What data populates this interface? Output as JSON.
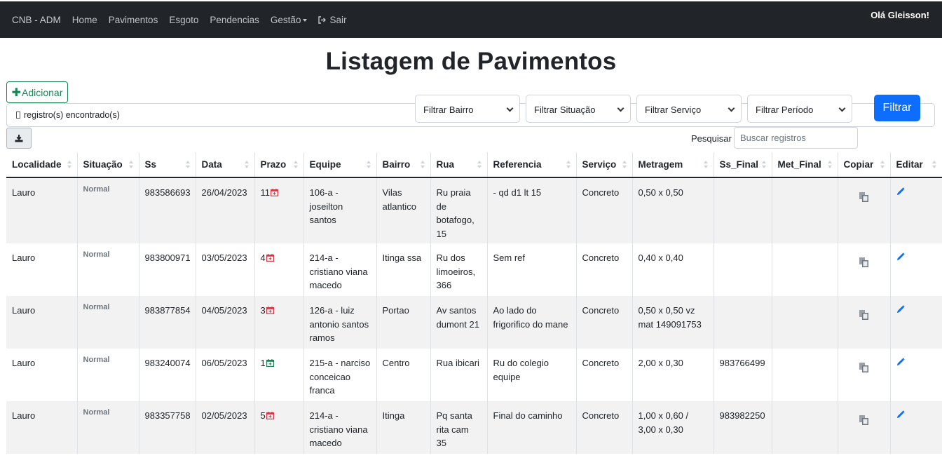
{
  "nav": {
    "brand": "CNB - ADM",
    "home": "Home",
    "pavimentos": "Pavimentos",
    "esgoto": "Esgoto",
    "pendencias": "Pendencias",
    "gestao": "Gestão",
    "sair": "Sair",
    "greeting": "Olá Gleisson!"
  },
  "page": {
    "title": "Listagem de Pavimentos"
  },
  "toolbar": {
    "add_label": "Adicionar",
    "records_text": "registro(s) encontrado(s)",
    "filter_bairro": "Filtrar Bairro",
    "filter_situacao": "Filtrar Situação",
    "filter_servico": "Filtrar Serviço",
    "filter_periodo": "Filtrar Período",
    "filter_button": "Filtrar",
    "search_label": "Pesquisar",
    "search_placeholder": "Buscar registros"
  },
  "table": {
    "headers": [
      "Localidade",
      "Situação",
      "Ss",
      "Data",
      "Prazo",
      "Equipe",
      "Bairro",
      "Rua",
      "Referencia",
      "Serviço",
      "Metragem",
      "Ss_Final",
      "Met_Final",
      "Copiar",
      "Editar"
    ],
    "rows": [
      {
        "localidade": "Lauro",
        "situacao": "Normal",
        "ss": "983586693",
        "data": "26/04/2023",
        "prazo": "11",
        "prazo_color": "#dc3545",
        "equipe": "106-a - joseilton santos",
        "bairro": "Vilas atlantico",
        "rua": "Ru praia de botafogo, 15",
        "referencia": "- qd d1 lt 15",
        "servico": "Concreto",
        "metragem": "0,50 x 0,50",
        "ss_final": "",
        "met_final": ""
      },
      {
        "localidade": "Lauro",
        "situacao": "Normal",
        "ss": "983800971",
        "data": "03/05/2023",
        "prazo": "4",
        "prazo_color": "#dc3545",
        "equipe": "214-a - cristiano viana macedo",
        "bairro": "Itinga ssa",
        "rua": "Ru dos limoeiros, 366",
        "referencia": "Sem ref",
        "servico": "Concreto",
        "metragem": "0,40 x 0,40",
        "ss_final": "",
        "met_final": ""
      },
      {
        "localidade": "Lauro",
        "situacao": "Normal",
        "ss": "983877854",
        "data": "04/05/2023",
        "prazo": "3",
        "prazo_color": "#dc3545",
        "equipe": "126-a - luiz antonio santos ramos",
        "bairro": "Portao",
        "rua": "Av santos dumont 21",
        "referencia": "Ao lado do frigorifico do mane",
        "servico": "Concreto",
        "metragem": "0,50 x 0,50 vz mat 149091753",
        "ss_final": "",
        "met_final": ""
      },
      {
        "localidade": "Lauro",
        "situacao": "Normal",
        "ss": "983240074",
        "data": "06/05/2023",
        "prazo": "1",
        "prazo_color": "#198754",
        "equipe": "215-a - narciso conceicao franca",
        "bairro": "Centro",
        "rua": "Rua ibicari",
        "referencia": "Ru do colegio equipe",
        "servico": "Concreto",
        "metragem": "2,00 x 0,30",
        "ss_final": "983766499",
        "met_final": ""
      },
      {
        "localidade": "Lauro",
        "situacao": "Normal",
        "ss": "983357758",
        "data": "02/05/2023",
        "prazo": "5",
        "prazo_color": "#dc3545",
        "equipe": "214-a - cristiano viana macedo",
        "bairro": "Itinga",
        "rua": "Pq santa rita cam 35",
        "referencia": "Final do caminho",
        "servico": "Concreto",
        "metragem": "1,00 x 0,60 / 3,00 x 0,30",
        "ss_final": "983982250",
        "met_final": ""
      }
    ]
  },
  "colors": {
    "navbar": "#212529",
    "primary": "#0d6efd",
    "success": "#198754",
    "danger": "#dc3545",
    "stripe": "#f2f2f2"
  }
}
